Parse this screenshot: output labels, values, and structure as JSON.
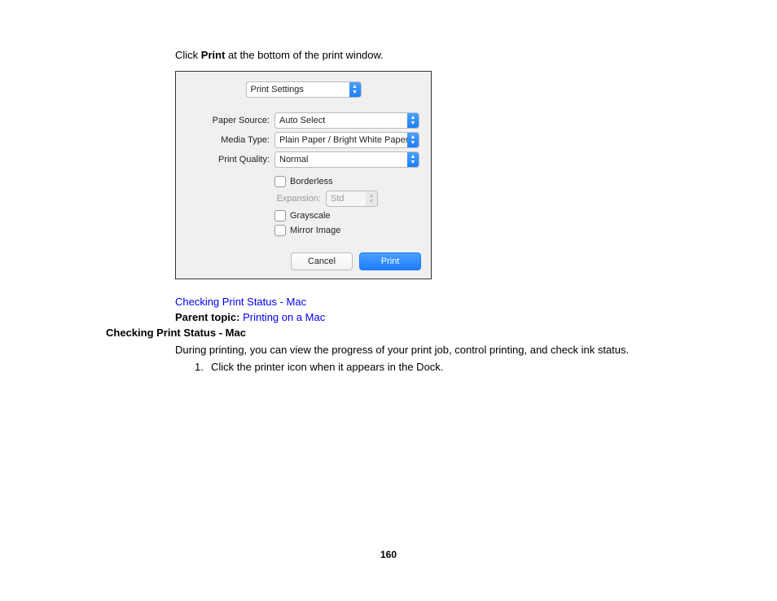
{
  "intro": {
    "pre": "Click ",
    "bold": "Print",
    "post": " at the bottom of the print window."
  },
  "dialog": {
    "tab": "Print Settings",
    "paperSourceLabel": "Paper Source:",
    "paperSourceValue": "Auto Select",
    "mediaTypeLabel": "Media Type:",
    "mediaTypeValue": "Plain Paper / Bright White Paper",
    "printQualityLabel": "Print Quality:",
    "printQualityValue": "Normal",
    "borderless": "Borderless",
    "expansionLabel": "Expansion:",
    "expansionValue": "Std",
    "grayscale": "Grayscale",
    "mirror": "Mirror Image",
    "cancel": "Cancel",
    "print": "Print"
  },
  "links": {
    "status": "Checking Print Status - Mac",
    "parentLabel": "Parent topic: ",
    "parentLink": "Printing on a Mac"
  },
  "sectionHeading": "Checking Print Status - Mac",
  "body": "During printing, you can view the progress of your print job, control printing, and check ink status.",
  "step1num": "1.",
  "step1text": "Click the printer icon when it appears in the Dock.",
  "pageNumber": "160"
}
